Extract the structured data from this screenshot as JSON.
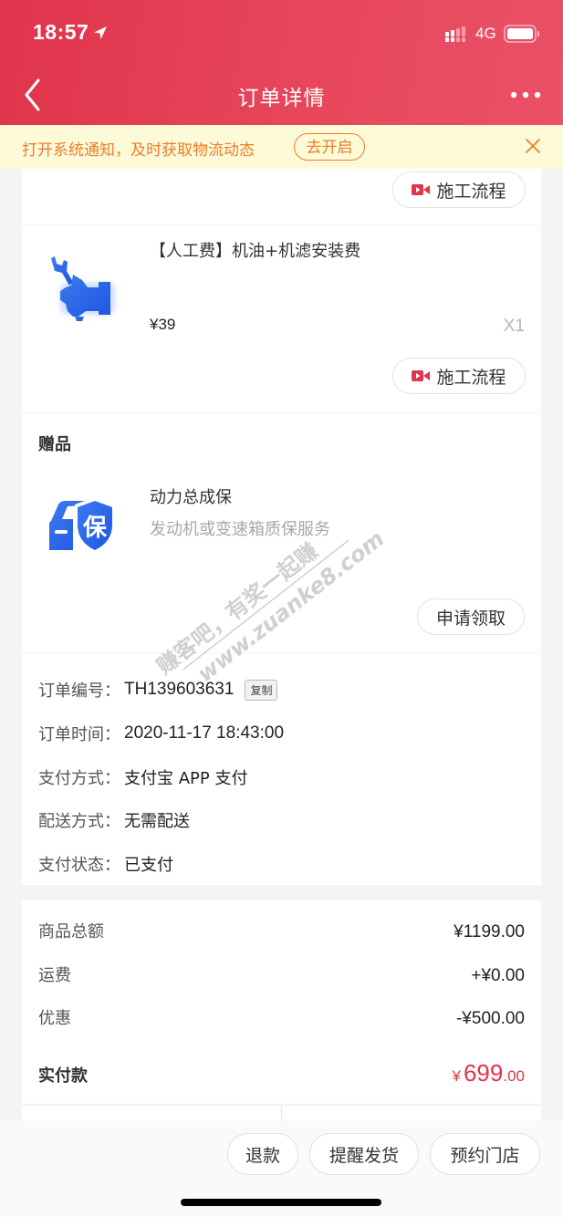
{
  "status_bar": {
    "time": "18:57",
    "network": "4G",
    "icons": [
      "location-arrow-icon",
      "signal-icon",
      "battery-icon"
    ]
  },
  "nav": {
    "title": "订单详情",
    "back_icon": "chevron-left-icon",
    "more_icon": "more-dots-icon"
  },
  "notice": {
    "text": "打开系统通知，及时获取物流动态",
    "button_label": "去开启",
    "close_icon": "close-icon"
  },
  "colors": {
    "brand_red": "#e3344b",
    "notice_orange": "#f07b2e",
    "notice_bg": "#fdfbd7",
    "icon_blue": "#2f66e8"
  },
  "top_card": {
    "process_button_label": "施工流程"
  },
  "product": {
    "title": "【人工费】机油+机滤安装费",
    "price": "¥39",
    "quantity": "X1",
    "image_icon": "wrench-hand-icon",
    "process_button_label": "施工流程"
  },
  "gift": {
    "heading": "赠品",
    "name": "动力总成保",
    "description": "发动机或变速箱质保服务",
    "image_icon": "car-shield-icon",
    "badge_char": "保",
    "claim_button_label": "申请领取"
  },
  "order_info": {
    "rows": [
      {
        "label": "订单编号：",
        "value": "TH139603631"
      },
      {
        "label": "订单时间：",
        "value": "2020-11-17 18:43:00"
      },
      {
        "label": "支付方式：",
        "value": "支付宝 APP 支付"
      },
      {
        "label": "配送方式：",
        "value": "无需配送"
      },
      {
        "label": "支付状态：",
        "value": "已支付"
      }
    ],
    "copy_label": "复制"
  },
  "summary": {
    "rows": [
      {
        "label": "商品总额",
        "value": "¥1199.00"
      },
      {
        "label": "运费",
        "value": "+¥0.00"
      },
      {
        "label": "优惠",
        "value": "-¥500.00"
      }
    ],
    "total_label": "实付款",
    "total_currency": "¥",
    "total_integer": "699",
    "total_decimal": ".00"
  },
  "actions": {
    "refund": "退款",
    "remind_shipping": "提醒发货",
    "book_store": "预约门店"
  },
  "watermark": {
    "line1": "赚客吧，有奖一起赚",
    "line2": "www.zuanke8.com"
  }
}
